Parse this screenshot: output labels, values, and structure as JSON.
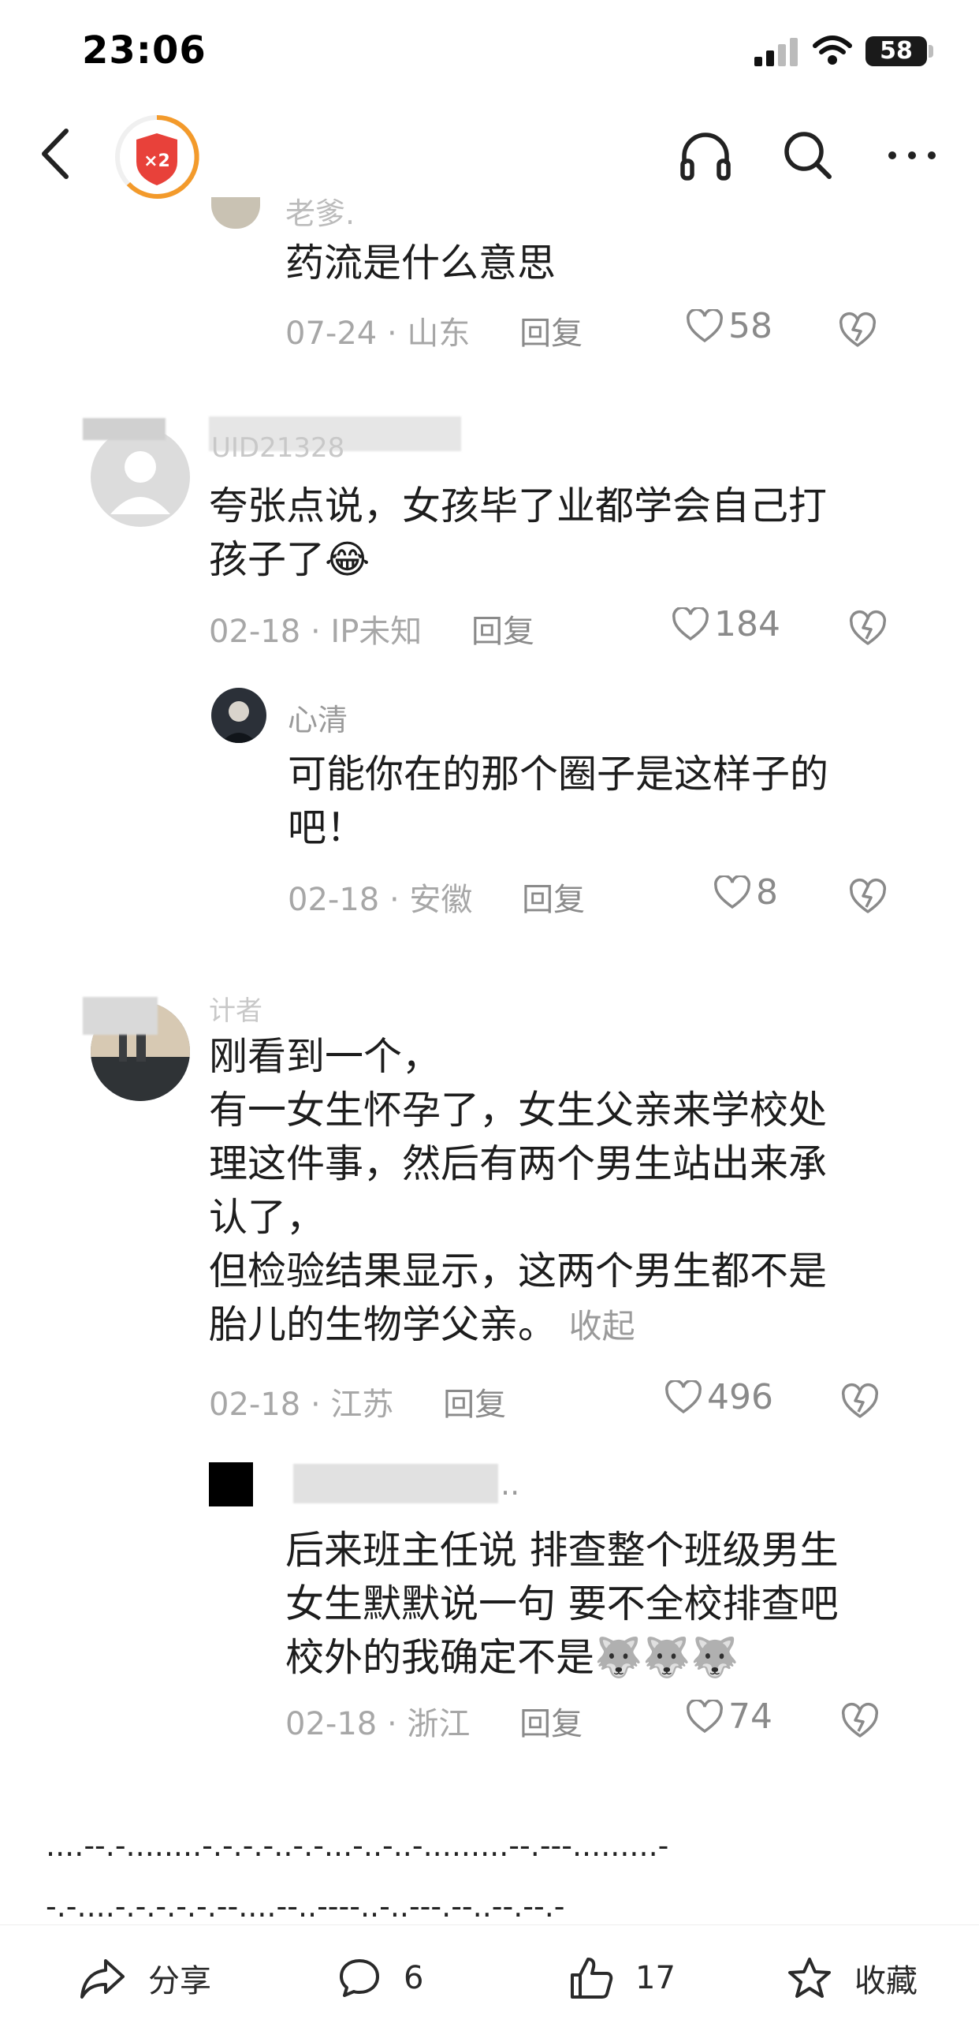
{
  "status": {
    "time": "23:06",
    "battery": "58"
  },
  "comments": [
    {
      "name": "老爹.",
      "text": [
        "药流是什么意思"
      ],
      "date": "07-24",
      "location": "山东",
      "reply": "回复",
      "likes": "58"
    },
    {
      "name": "UID21328",
      "text": [
        "夸张点说，女孩毕了业都学会自己打",
        "孩子了😂"
      ],
      "date": "02-18",
      "location": "IP未知",
      "reply": "回复",
      "likes": "184"
    },
    {
      "name": "心清",
      "text": [
        "可能你在的那个圈子是这样子的",
        "吧！"
      ],
      "date": "02-18",
      "location": "安徽",
      "reply": "回复",
      "likes": "8"
    },
    {
      "name": "计者",
      "text": [
        "刚看到一个，",
        "有一女生怀孕了，女生父亲来学校处",
        "理这件事，然后有两个男生站出来承",
        "认了，",
        "但检验结果显示，这两个男生都不是",
        "胎儿的生物学父亲。"
      ],
      "collapse": "收起",
      "date": "02-18",
      "location": "江苏",
      "reply": "回复",
      "likes": "496"
    },
    {
      "name": "..",
      "text": [
        "后来班主任说 排查整个班级男生",
        "女生默默说一句  要不全校排查吧",
        "校外的我确定不是🐺🐺🐺"
      ],
      "date": "02-18",
      "location": "浙江",
      "reply": "回复",
      "likes": "74"
    }
  ],
  "separator": [
    "....--.-........-.-.-.-..-.-...-..-..-.........--.---.........-",
    "-.-....-.-.-.-.-.--....--..----..-..---.--..--.--.-"
  ],
  "toolbar": {
    "share": "分享",
    "comments": "6",
    "likes": "17",
    "favorite": "收藏"
  },
  "colors": {
    "heart": "#8a8a8a",
    "badge": "#e8413a",
    "ring": "#f39a2b"
  }
}
